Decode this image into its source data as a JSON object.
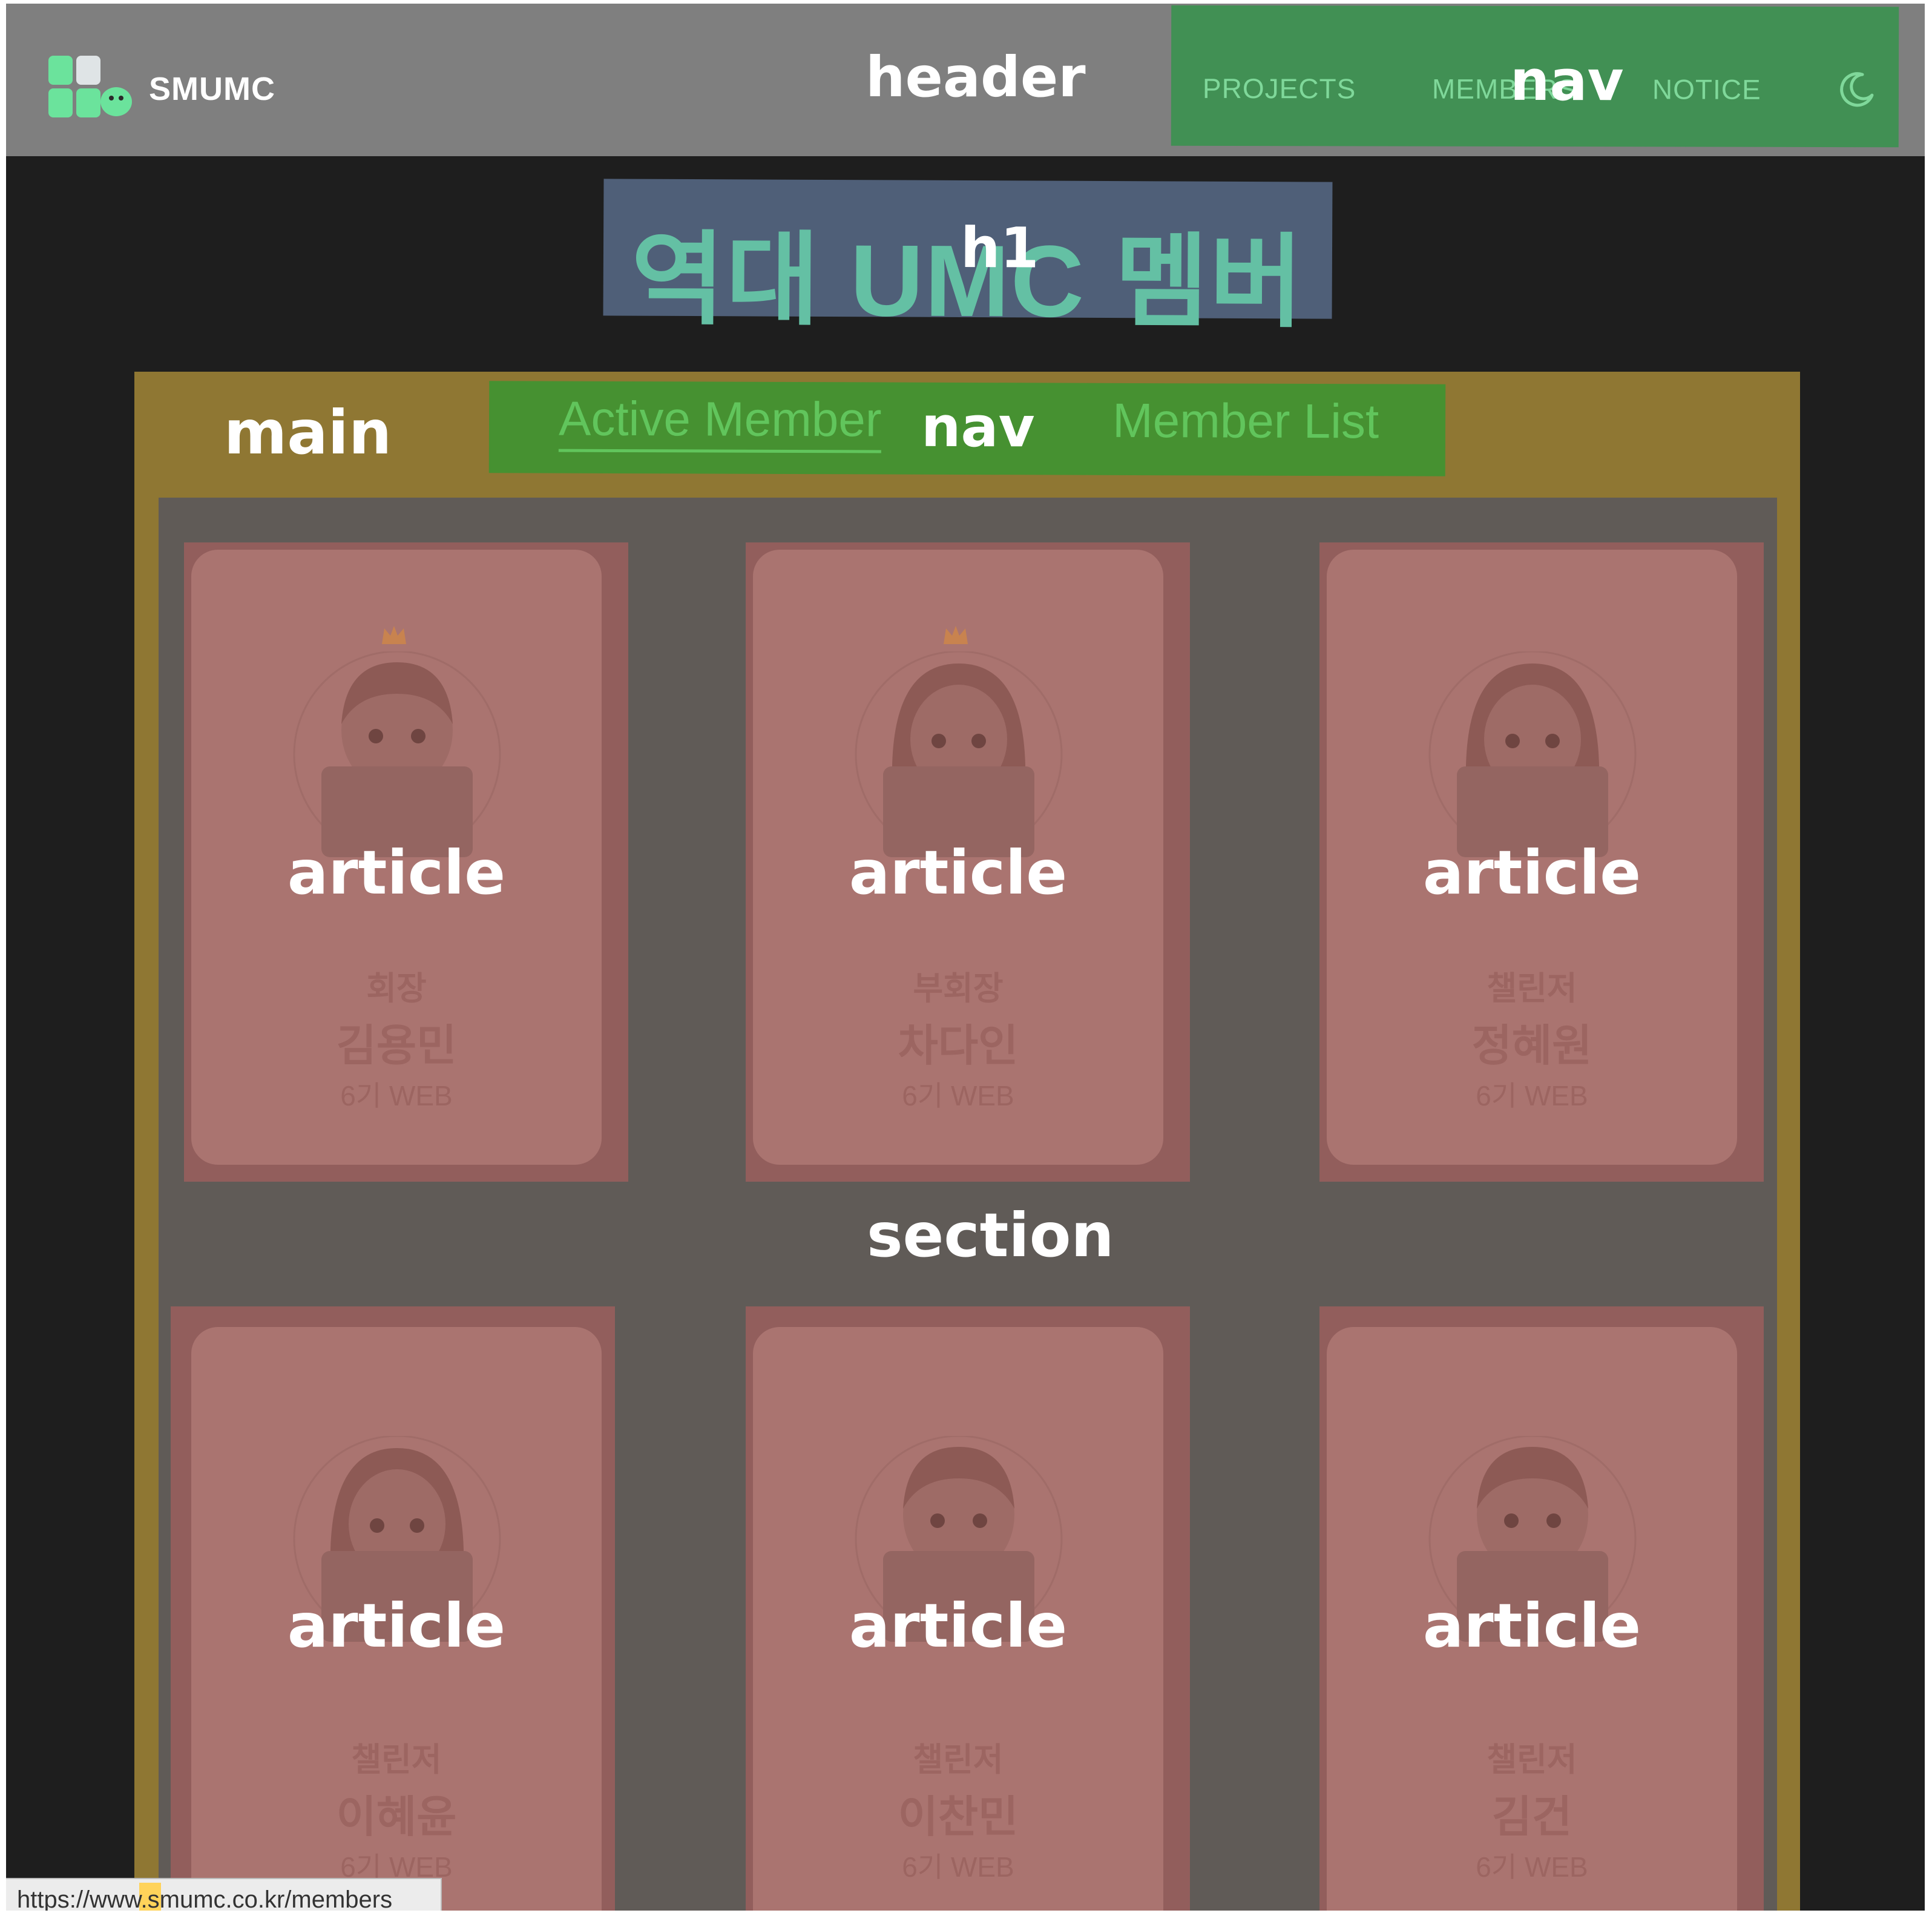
{
  "header": {
    "brand": "SMUMC",
    "overlay_label": "header",
    "nav": {
      "overlay_label": "nav",
      "items": [
        "PROJECTS",
        "MEMBERS",
        "NOTICE"
      ],
      "theme_toggle_icon": "moon-icon"
    }
  },
  "hero": {
    "title": "역대 UMC 멤버",
    "overlay_label": "h1"
  },
  "main": {
    "overlay_label": "main",
    "tabs": {
      "overlay_label": "nav",
      "active": "Active Member",
      "list": "Member List"
    },
    "section_label": "section",
    "members": [
      {
        "role": "회장",
        "name": "김용민",
        "gen": "6기 WEB",
        "avatar": "male-laptop-avatar",
        "crown": true
      },
      {
        "role": "부회장",
        "name": "차다인",
        "gen": "6기 WEB",
        "avatar": "female-laptop-avatar",
        "crown": true
      },
      {
        "role": "챌린저",
        "name": "정혜원",
        "gen": "6기 WEB",
        "avatar": "female-laptop-avatar",
        "crown": false
      },
      {
        "role": "챌린저",
        "name": "이혜윤",
        "gen": "6기 WEB",
        "avatar": "female-laptop-avatar",
        "crown": false
      },
      {
        "role": "챌린저",
        "name": "이찬민",
        "gen": "6기 WEB",
        "avatar": "male-laptop-avatar",
        "crown": false
      },
      {
        "role": "챌린저",
        "name": "김건",
        "gen": "6기 WEB",
        "avatar": "male-laptop-avatar",
        "crown": false
      }
    ],
    "article_label": "article"
  },
  "statusbar": {
    "url": "https://www.smumc.co.kr/members"
  },
  "colors": {
    "header_overlay": "#7f7f7f",
    "nav_overlay": "#419054",
    "h1_overlay": "#4f5f78",
    "main_overlay": "#8f7733",
    "section_overlay": "#605b57",
    "article_overlay": "#925e5c",
    "accent": "#64c0a4"
  }
}
